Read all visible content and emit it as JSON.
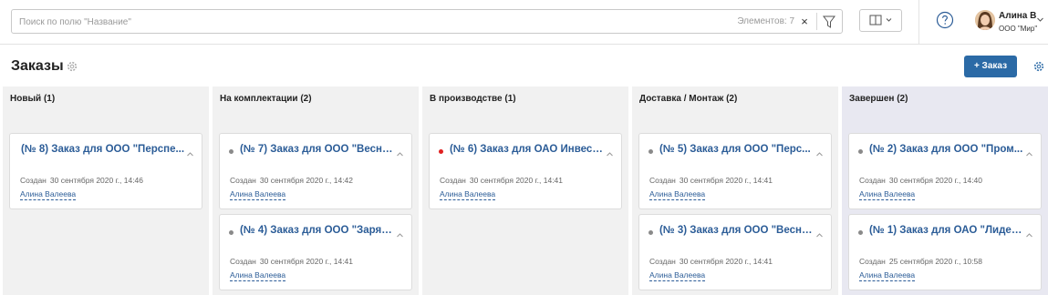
{
  "topbar": {
    "search_placeholder": "Поиск по полю \"Название\"",
    "search_value": "",
    "elements_count": "Элементов: 7",
    "clear_glyph": "×",
    "filter_icon": "filter-icon",
    "columns_icon": "columns-layout-icon",
    "help_icon": "help-circle-icon",
    "user_name": "Алина В",
    "user_org": "ООО \"Мир\""
  },
  "page": {
    "title": "Заказы",
    "add_button_label": "+ Заказ"
  },
  "colors": {
    "accent": "#2b6aa6",
    "link": "#2b5c97",
    "column_bg": "#f1f1f1",
    "done_column_bg": "#e8e8f1",
    "dot_default": "#8a8a8a",
    "dot_red": "#e02020"
  },
  "board": {
    "columns": [
      {
        "title": "Новый (1)",
        "cards": [
          {
            "title": "(№ 8) Заказ для ООО \"Перспе...",
            "dot": "none",
            "created_label": "Создан",
            "created_date": "30 сентября 2020 г., 14:46",
            "author": "Алина Валеева"
          }
        ]
      },
      {
        "title": "На комплектации (2)",
        "cards": [
          {
            "title": "(№ 7) Заказ для ООО \"Весна\"...",
            "dot": "grey",
            "created_label": "Создан",
            "created_date": "30 сентября 2020 г., 14:42",
            "author": "Алина Валеева"
          },
          {
            "title": "(№ 4) Заказ для ООО \"Заря\"...",
            "dot": "grey",
            "created_label": "Создан",
            "created_date": "30 сентября 2020 г., 14:41",
            "author": "Алина Валеева"
          }
        ]
      },
      {
        "title": "В производстве (1)",
        "cards": [
          {
            "title": "(№ 6) Заказ для ОАО Инвест...",
            "dot": "red",
            "created_label": "Создан",
            "created_date": "30 сентября 2020 г., 14:41",
            "author": "Алина Валеева"
          }
        ]
      },
      {
        "title": "Доставка / Монтаж (2)",
        "cards": [
          {
            "title": "(№ 5) Заказ для ООО \"Перс...",
            "dot": "grey",
            "created_label": "Создан",
            "created_date": "30 сентября 2020 г., 14:41",
            "author": "Алина Валеева"
          },
          {
            "title": "(№ 3) Заказ для ООО \"Весна...",
            "dot": "grey",
            "created_label": "Создан",
            "created_date": "30 сентября 2020 г., 14:41",
            "author": "Алина Валеева"
          }
        ]
      },
      {
        "title": "Завершен (2)",
        "cards": [
          {
            "title": "(№ 2) Заказ для ООО \"Пром...",
            "dot": "grey",
            "created_label": "Создан",
            "created_date": "30 сентября 2020 г., 14:40",
            "author": "Алина Валеева"
          },
          {
            "title": "(№ 1) Заказ для ОАО \"Лидер...",
            "dot": "grey",
            "created_label": "Создан",
            "created_date": "25 сентября 2020 г., 10:58",
            "author": "Алина Валеева"
          }
        ]
      }
    ]
  }
}
